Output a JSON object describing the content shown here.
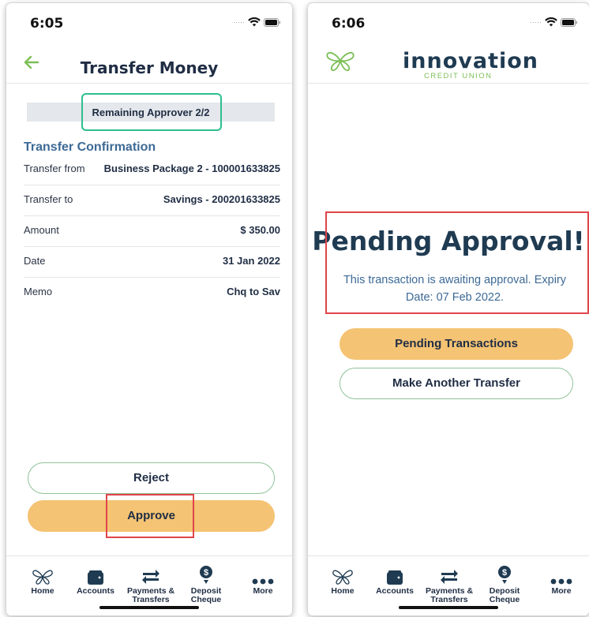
{
  "left_screen": {
    "status_time": "6:05",
    "header_title": "Transfer Money",
    "approver_label": "Remaining Approver 2/2",
    "section_title": "Transfer Confirmation",
    "rows": [
      {
        "label": "Transfer from",
        "value": "Business Package 2 - 100001633825"
      },
      {
        "label": "Transfer to",
        "value": "Savings - 200201633825"
      },
      {
        "label": "Amount",
        "value": "$ 350.00"
      },
      {
        "label": "Date",
        "value": "31 Jan 2022"
      },
      {
        "label": "Memo",
        "value": "Chq to Sav"
      }
    ],
    "reject_label": "Reject",
    "approve_label": "Approve"
  },
  "right_screen": {
    "status_time": "6:06",
    "logo_text": "innovation",
    "logo_subtext": "CREDIT UNION",
    "pending_title": "Pending Approval!",
    "pending_desc": "This transaction is awaiting approval. Expiry Date: 07 Feb 2022.",
    "pending_transactions_label": "Pending Transactions",
    "make_another_label": "Make Another Transfer"
  },
  "nav": {
    "home": "Home",
    "accounts": "Accounts",
    "payments_line1": "Payments &",
    "payments_line2": "Transfers",
    "deposit_line1": "Deposit",
    "deposit_line2": "Cheque",
    "more": "More"
  },
  "icons": [
    "back-arrow-icon",
    "wifi-icon",
    "battery-icon",
    "butterfly-icon",
    "wallet-icon",
    "transfer-arrows-icon",
    "deposit-cheque-icon",
    "more-dots-icon"
  ],
  "colors": {
    "accent_green": "#7cbf57",
    "approve_fill": "#f4c373",
    "title_navy": "#1f3b52",
    "section_blue": "#3d6a96",
    "highlight_red": "#e0454a",
    "highlight_teal": "#2dbf8e"
  }
}
